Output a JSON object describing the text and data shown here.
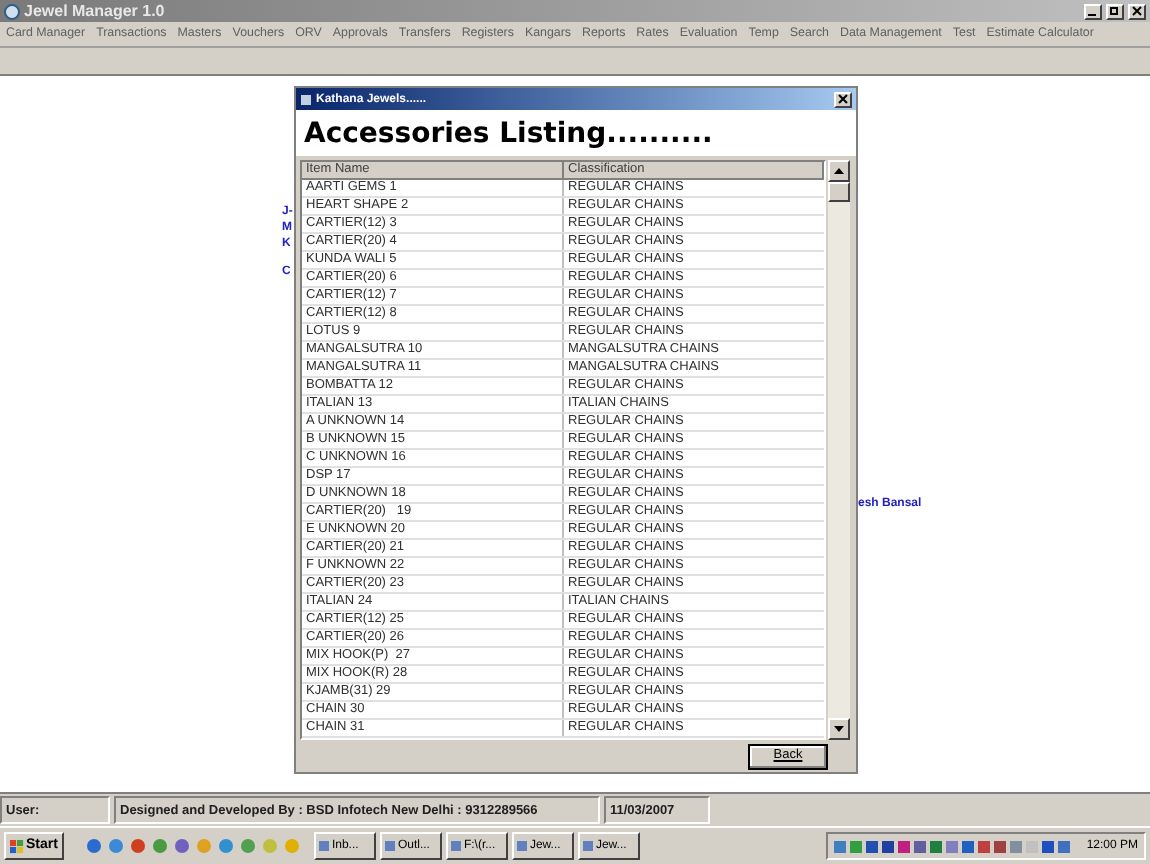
{
  "window": {
    "title": "Jewel Manager 1.0"
  },
  "menu": [
    "Card Manager",
    "Transactions",
    "Masters",
    "Vouchers",
    "ORV",
    "Approvals",
    "Transfers",
    "Registers",
    "Kangars",
    "Reports",
    "Rates",
    "Evaluation",
    "Temp",
    "Search",
    "Data Management",
    "Test",
    "Estimate Calculator"
  ],
  "background_labels_left": [
    "J-",
    "M",
    "K",
    "C"
  ],
  "background_label_right": "esh Bansal",
  "dialog": {
    "title": "Kathana Jewels......",
    "heading": "Accessories Listing..........",
    "columns": [
      "Item Name",
      "Classification"
    ],
    "rows": [
      {
        "item": "AARTI GEMS 1",
        "classification": "REGULAR CHAINS"
      },
      {
        "item": "HEART SHAPE 2",
        "classification": "REGULAR CHAINS"
      },
      {
        "item": "CARTIER(12) 3",
        "classification": "REGULAR CHAINS"
      },
      {
        "item": "CARTIER(20) 4",
        "classification": "REGULAR CHAINS"
      },
      {
        "item": "KUNDA WALI 5",
        "classification": "REGULAR CHAINS"
      },
      {
        "item": "CARTIER(20) 6",
        "classification": "REGULAR CHAINS"
      },
      {
        "item": "CARTIER(12) 7",
        "classification": "REGULAR CHAINS"
      },
      {
        "item": "CARTIER(12) 8",
        "classification": "REGULAR CHAINS"
      },
      {
        "item": "LOTUS 9",
        "classification": "REGULAR CHAINS"
      },
      {
        "item": "MANGALSUTRA 10",
        "classification": "MANGALSUTRA CHAINS"
      },
      {
        "item": "MANGALSUTRA 11",
        "classification": "MANGALSUTRA CHAINS"
      },
      {
        "item": "BOMBATTA 12",
        "classification": "REGULAR CHAINS"
      },
      {
        "item": "ITALIAN 13",
        "classification": "ITALIAN CHAINS"
      },
      {
        "item": "A UNKNOWN 14",
        "classification": "REGULAR CHAINS"
      },
      {
        "item": "B UNKNOWN 15",
        "classification": "REGULAR CHAINS"
      },
      {
        "item": "C UNKNOWN 16",
        "classification": "REGULAR CHAINS"
      },
      {
        "item": "DSP 17",
        "classification": "REGULAR CHAINS"
      },
      {
        "item": "D UNKNOWN 18",
        "classification": "REGULAR CHAINS"
      },
      {
        "item": "CARTIER(20)   19",
        "classification": "REGULAR CHAINS"
      },
      {
        "item": "E UNKNOWN 20",
        "classification": "REGULAR CHAINS"
      },
      {
        "item": "CARTIER(20) 21",
        "classification": "REGULAR CHAINS"
      },
      {
        "item": "F UNKNOWN 22",
        "classification": "REGULAR CHAINS"
      },
      {
        "item": "CARTIER(20) 23",
        "classification": "REGULAR CHAINS"
      },
      {
        "item": "ITALIAN 24",
        "classification": "ITALIAN CHAINS"
      },
      {
        "item": "CARTIER(12) 25",
        "classification": "REGULAR CHAINS"
      },
      {
        "item": "CARTIER(20) 26",
        "classification": "REGULAR CHAINS"
      },
      {
        "item": "MIX HOOK(P)  27",
        "classification": "REGULAR CHAINS"
      },
      {
        "item": "MIX HOOK(R) 28",
        "classification": "REGULAR CHAINS"
      },
      {
        "item": "KJAMB(31) 29",
        "classification": "REGULAR CHAINS"
      },
      {
        "item": "CHAIN 30",
        "classification": "REGULAR CHAINS"
      },
      {
        "item": "CHAIN 31",
        "classification": "REGULAR CHAINS"
      }
    ],
    "back_button": "Back"
  },
  "status_bar": [
    "User:",
    "Designed and Developed By : BSD Infotech New Delhi : 9312289566",
    "11/03/2007"
  ],
  "taskbar": {
    "start": "Start",
    "tasks": [
      "Inb...",
      "Outl...",
      "F:\\(r...",
      "Jew...",
      "Jew..."
    ],
    "clock": "12:00 PM"
  }
}
